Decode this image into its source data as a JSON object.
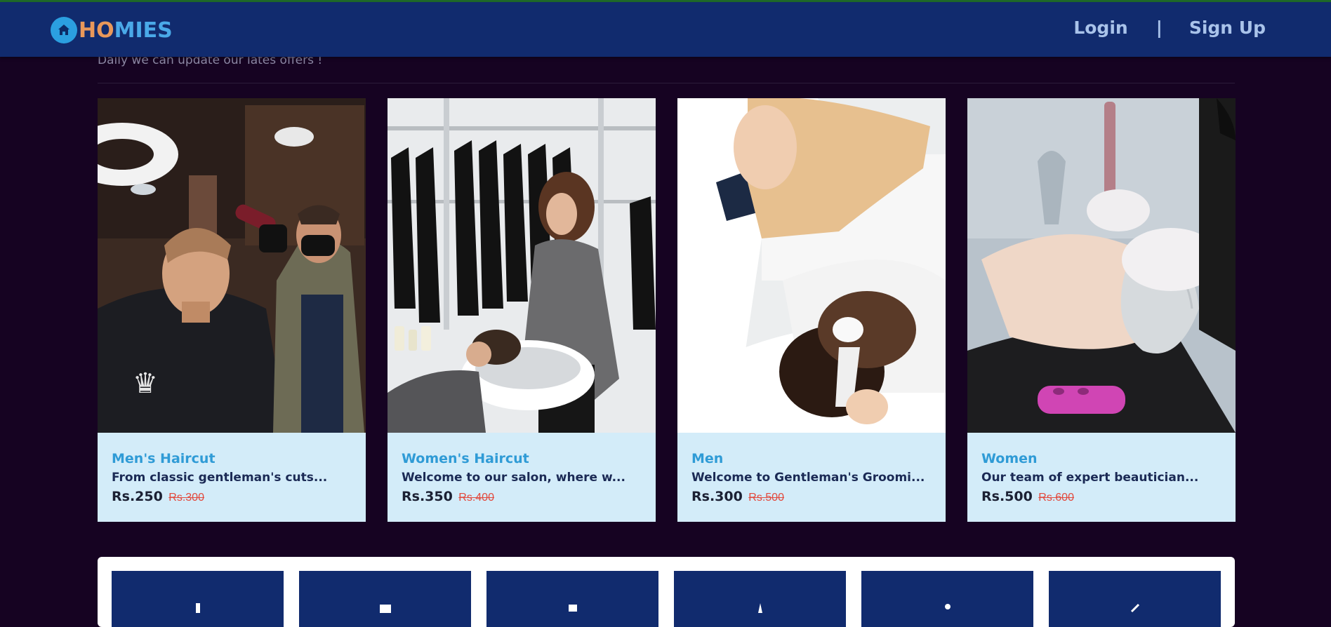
{
  "brand": {
    "logo_part1": "HO",
    "logo_part2": "MIES",
    "icon": "home-icon"
  },
  "nav": {
    "login": "Login",
    "separator": "|",
    "signup": "Sign Up"
  },
  "offers": {
    "subtitle": "Daily we can update our lates offers !"
  },
  "cards": [
    {
      "title": "Men's Haircut",
      "desc": "From classic gentleman's cuts...",
      "price": "Rs.250",
      "old_price": "Rs.300"
    },
    {
      "title": "Women's Haircut",
      "desc": "Welcome to our salon, where w...",
      "price": "Rs.350",
      "old_price": "Rs.400"
    },
    {
      "title": "Men",
      "desc": "Welcome to Gentleman's Groomi...",
      "price": "Rs.300",
      "old_price": "Rs.500"
    },
    {
      "title": "Women",
      "desc": "Our team of expert beautician...",
      "price": "Rs.500",
      "old_price": "Rs.600"
    }
  ],
  "colors": {
    "page_bg": "#160322",
    "navbar": "#112b6e",
    "card_bg": "#d3ecf9",
    "title_accent": "#2f9bd6",
    "old_price": "#e24a3e"
  }
}
